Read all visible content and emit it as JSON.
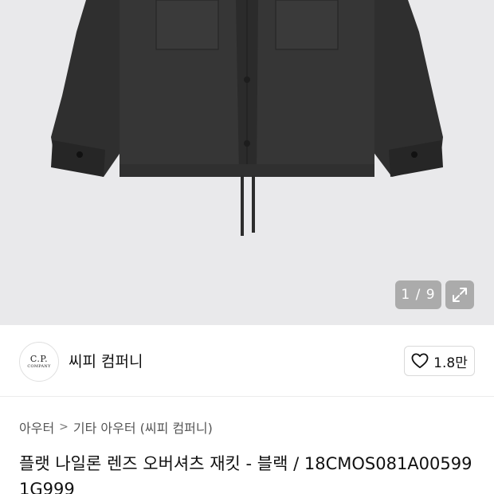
{
  "gallery": {
    "counter": "1 / 9",
    "expand_icon": "expand-icon",
    "background_color": "#e9e9eb",
    "product_color": "#333333"
  },
  "brand": {
    "logo_line1": "C.P.",
    "logo_line2": "COMPANY",
    "name": "씨피 컴퍼니"
  },
  "like": {
    "icon": "heart-outline-icon",
    "count": "1.8만"
  },
  "breadcrumb": {
    "level1": "아우터",
    "separator": ">",
    "level2": "기타 아우터 (씨피 컴퍼니)"
  },
  "product": {
    "title": "플랫 나일론 렌즈 오버셔츠 재킷 - 블랙 / 18CMOS081A005991G999"
  }
}
